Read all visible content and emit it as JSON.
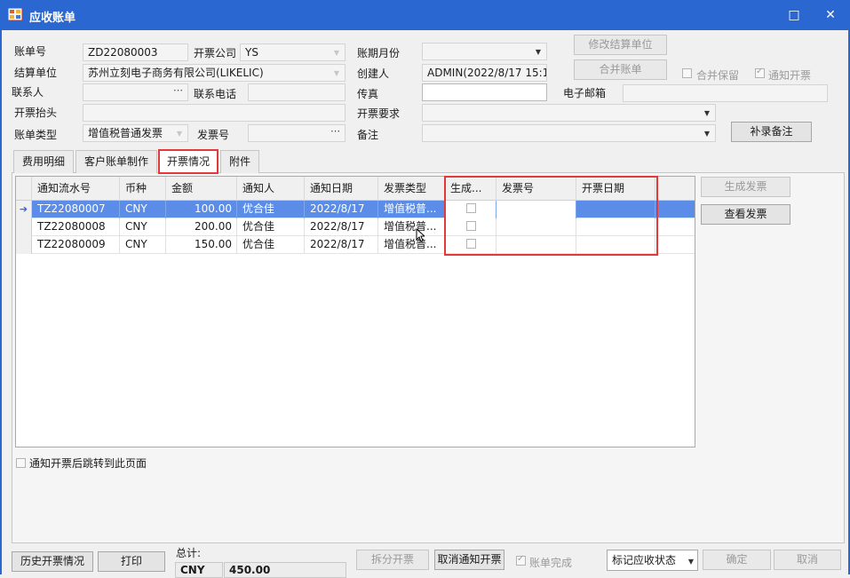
{
  "window": {
    "title": "应收账单",
    "icon": "app-grid-icon",
    "minimize_glyph": "□",
    "close_glyph": "✕"
  },
  "form": {
    "bill_no_label": "账单号",
    "bill_no": "ZD22080003",
    "invoice_company_label": "开票公司",
    "invoice_company": "YS",
    "period_label": "账期月份",
    "period": "",
    "settle_unit_label": "结算单位",
    "settle_unit": "苏州立刻电子商务有限公司(LIKELIC)",
    "creator_label": "创建人",
    "creator": "ADMIN(2022/8/17 15:1",
    "contact_label": "联系人",
    "contact": "",
    "phone_label": "联系电话",
    "phone": "",
    "fax_label": "传真",
    "fax": "",
    "email_label": "电子邮箱",
    "email": "",
    "invoice_title_label": "开票抬头",
    "invoice_title": "",
    "invoice_req_label": "开票要求",
    "invoice_req": "",
    "bill_type_label": "账单类型",
    "bill_type": "增值税普通发票",
    "invoice_no_label": "发票号",
    "invoice_no": "",
    "remark_label": "备注",
    "remark": ""
  },
  "buttons": {
    "modify_settle": "修改结算单位",
    "merge_bill": "合并账单",
    "add_remark": "补录备注",
    "gen_invoice": "生成发票",
    "view_invoice": "查看发票",
    "history": "历史开票情况",
    "print": "打印",
    "split": "拆分开票",
    "cancel_notice": "取消通知开票",
    "mark_status": "标记应收状态",
    "confirm": "确定",
    "cancel": "取消"
  },
  "checks": {
    "merge_keep": "合并保留",
    "notify_invoice": "通知开票",
    "jump_after_notify": "通知开票后跳转到此页面",
    "bill_complete": "账单完成"
  },
  "tabs": [
    {
      "label": "费用明细"
    },
    {
      "label": "客户账单制作"
    },
    {
      "label": "开票情况"
    },
    {
      "label": "附件"
    }
  ],
  "grid": {
    "columns": [
      "通知流水号",
      "币种",
      "金额",
      "通知人",
      "通知日期",
      "发票类型",
      "生成...",
      "发票号",
      "开票日期"
    ],
    "rows": [
      {
        "serial": "TZ22080007",
        "currency": "CNY",
        "amount": "100.00",
        "notifier": "优合佳",
        "date": "2022/8/17",
        "type": "增值税普...",
        "generated": false,
        "invoice_no": "",
        "invoice_date": ""
      },
      {
        "serial": "TZ22080008",
        "currency": "CNY",
        "amount": "200.00",
        "notifier": "优合佳",
        "date": "2022/8/17",
        "type": "增值税普...",
        "generated": false,
        "invoice_no": "",
        "invoice_date": ""
      },
      {
        "serial": "TZ22080009",
        "currency": "CNY",
        "amount": "150.00",
        "notifier": "优合佳",
        "date": "2022/8/17",
        "type": "增值税普...",
        "generated": false,
        "invoice_no": "",
        "invoice_date": ""
      }
    ],
    "selected_row_marker": "➔"
  },
  "summary": {
    "label": "总计:",
    "currency": "CNY",
    "total": "450.00"
  },
  "colors": {
    "titlebar": "#2b67d0",
    "selection": "#5b8de8",
    "highlight": "#e23a3a"
  }
}
